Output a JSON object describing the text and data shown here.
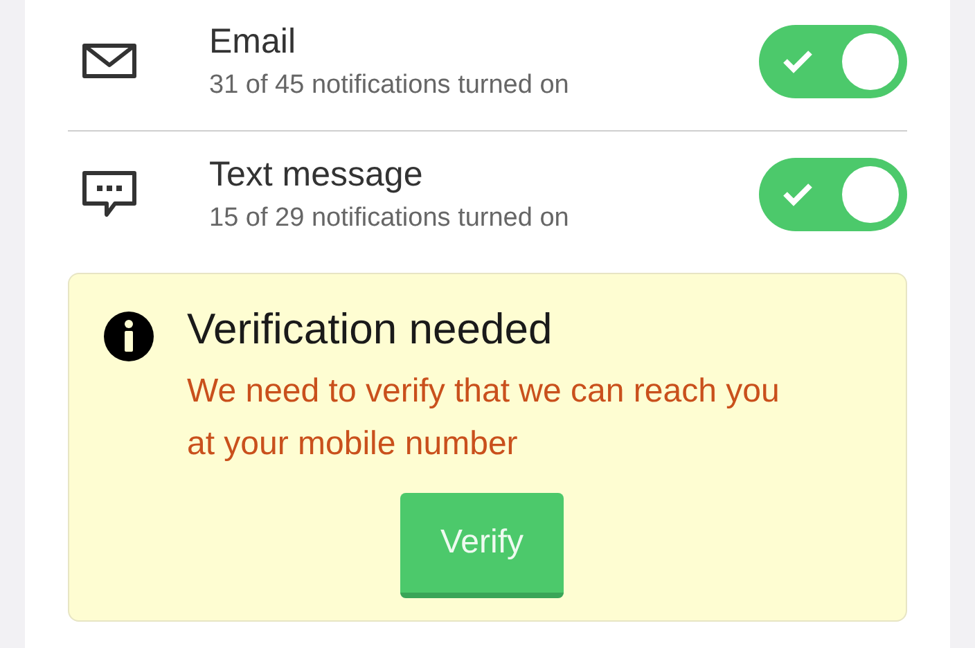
{
  "channels": [
    {
      "kind": "email",
      "name": "Email",
      "summary": "31 of 45 notifications turned on",
      "on": true
    },
    {
      "kind": "text",
      "name": "Text message",
      "summary": "15 of 29 notifications turned on",
      "on": true
    }
  ],
  "alert": {
    "title": "Verification needed",
    "message": "We need to verify that we can reach you at your mobile number",
    "button": "Verify"
  }
}
